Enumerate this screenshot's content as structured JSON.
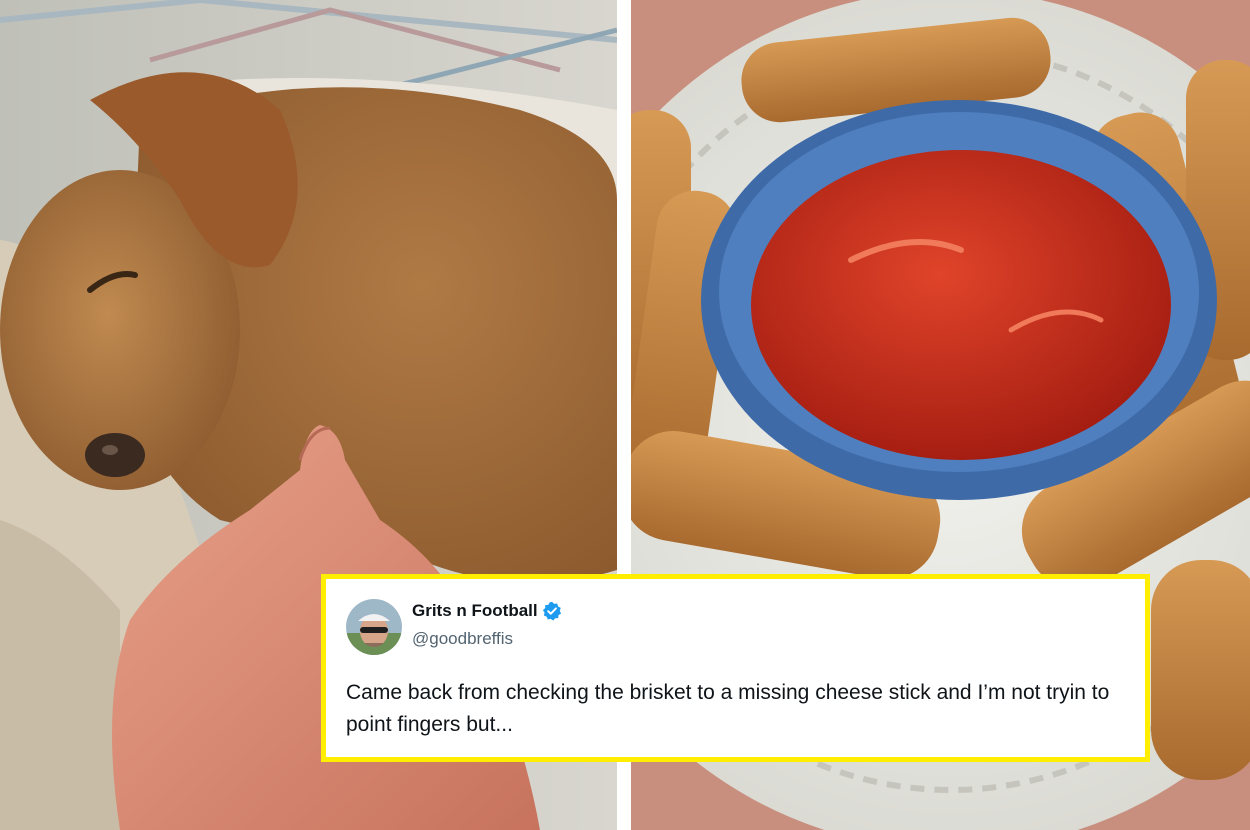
{
  "tweet": {
    "display_name": "Grits n Football",
    "handle": "@goodbreffis",
    "text": "Came back from checking the brisket to a missing cheese stick and I’m not tryin to point fingers but...",
    "verified": true,
    "verified_color": "#1d9bf0",
    "border_color": "#ffee00"
  },
  "photos": {
    "left": {
      "icon": "dog-photo"
    },
    "right": {
      "icon": "cheese-sticks-photo"
    }
  }
}
